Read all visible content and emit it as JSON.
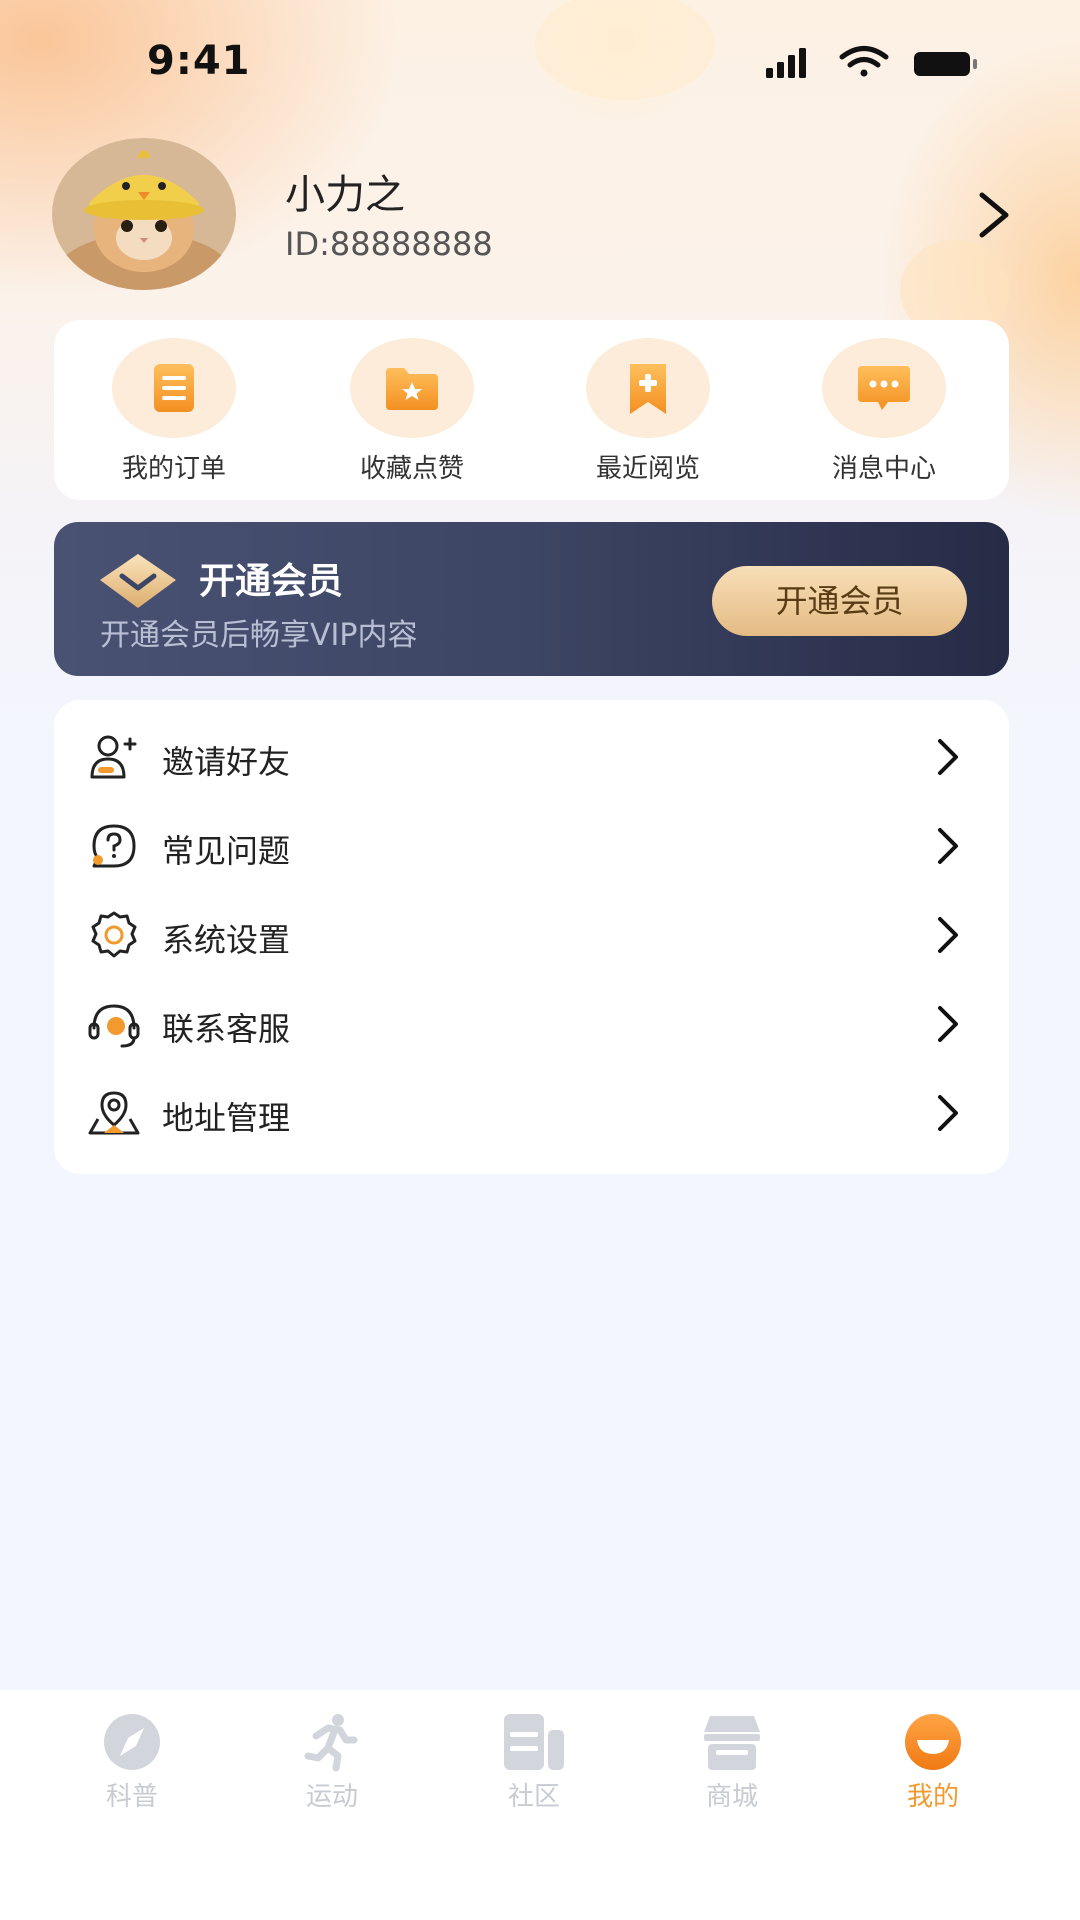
{
  "status_bar": {
    "time": "9:41"
  },
  "profile": {
    "name": "小力之",
    "id_text": "ID:88888888"
  },
  "quick_actions": [
    {
      "label": "我的订单",
      "icon": "order-list-icon"
    },
    {
      "label": "收藏点赞",
      "icon": "favorite-folder-icon"
    },
    {
      "label": "最近阅览",
      "icon": "bookmark-plus-icon"
    },
    {
      "label": "消息中心",
      "icon": "message-bubble-icon"
    }
  ],
  "vip": {
    "title": "开通会员",
    "subtitle": "开通会员后畅享VIP内容",
    "button_label": "开通会员"
  },
  "menu": [
    {
      "label": "邀请好友",
      "icon": "invite-friend-icon"
    },
    {
      "label": "常见问题",
      "icon": "faq-question-icon"
    },
    {
      "label": "系统设置",
      "icon": "settings-gear-icon"
    },
    {
      "label": "联系客服",
      "icon": "customer-service-headset-icon"
    },
    {
      "label": "地址管理",
      "icon": "address-location-icon"
    }
  ],
  "tab_bar": {
    "active": "我的",
    "items": [
      {
        "label": "科普",
        "icon": "compass-icon"
      },
      {
        "label": "运动",
        "icon": "running-person-icon"
      },
      {
        "label": "社区",
        "icon": "community-icon"
      },
      {
        "label": "商城",
        "icon": "store-icon"
      },
      {
        "label": "我的",
        "icon": "profile-icon"
      }
    ]
  },
  "colors": {
    "accent": "#f29a2e",
    "accent_light": "#fdecd9",
    "vip_dark": "#2f3552",
    "vip_gold": "#e4bb84",
    "inactive_tab": "#c8cbd2",
    "page_background": "#f3f6fe"
  }
}
